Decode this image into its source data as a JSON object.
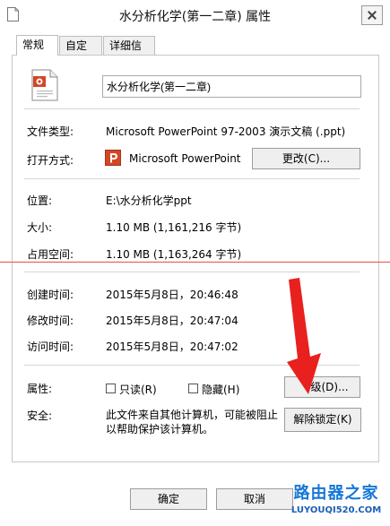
{
  "window": {
    "title": "水分析化学(第一二章) 属性"
  },
  "tabs": [
    {
      "label": "常规",
      "active": true
    },
    {
      "label": "自定义",
      "active": false
    },
    {
      "label": "详细信息",
      "active": false
    }
  ],
  "file": {
    "name": "水分析化学(第一二章)",
    "type_label": "文件类型:",
    "type_value": "Microsoft PowerPoint 97-2003 演示文稿 (.ppt)",
    "opens_with_label": "打开方式:",
    "opens_with_value": "Microsoft PowerPoint",
    "change_button": "更改(C)...",
    "location_label": "位置:",
    "location_value": "E:\\水分析化学ppt",
    "size_label": "大小:",
    "size_value": "1.10 MB (1,161,216 字节)",
    "size_on_disk_label": "占用空间:",
    "size_on_disk_value": "1.10 MB (1,163,264 字节)"
  },
  "dates": {
    "created_label": "创建时间:",
    "created_value": "2015年5月8日，20:46:48",
    "modified_label": "修改时间:",
    "modified_value": "2015年5月8日，20:47:04",
    "accessed_label": "访问时间:",
    "accessed_value": "2015年5月8日，20:47:02"
  },
  "attributes": {
    "label": "属性:",
    "readonly_label": "只读(R)",
    "readonly_checked": false,
    "hidden_label": "隐藏(H)",
    "hidden_checked": false,
    "advanced_button": "级(D)..."
  },
  "security": {
    "label": "安全:",
    "text": "此文件来自其他计算机，可能被阻止以帮助保护该计算机。",
    "unblock_button": "解除锁定(K)"
  },
  "footer": {
    "ok_button": "确定",
    "cancel_button": "取消"
  },
  "watermark": {
    "main": "路由器之家",
    "sub": "LUYOUQI520.COM"
  },
  "colors": {
    "annotation_arrow": "#e8201e",
    "annotation_line": "#e84c4c",
    "ppt_orange": "#d24726"
  }
}
